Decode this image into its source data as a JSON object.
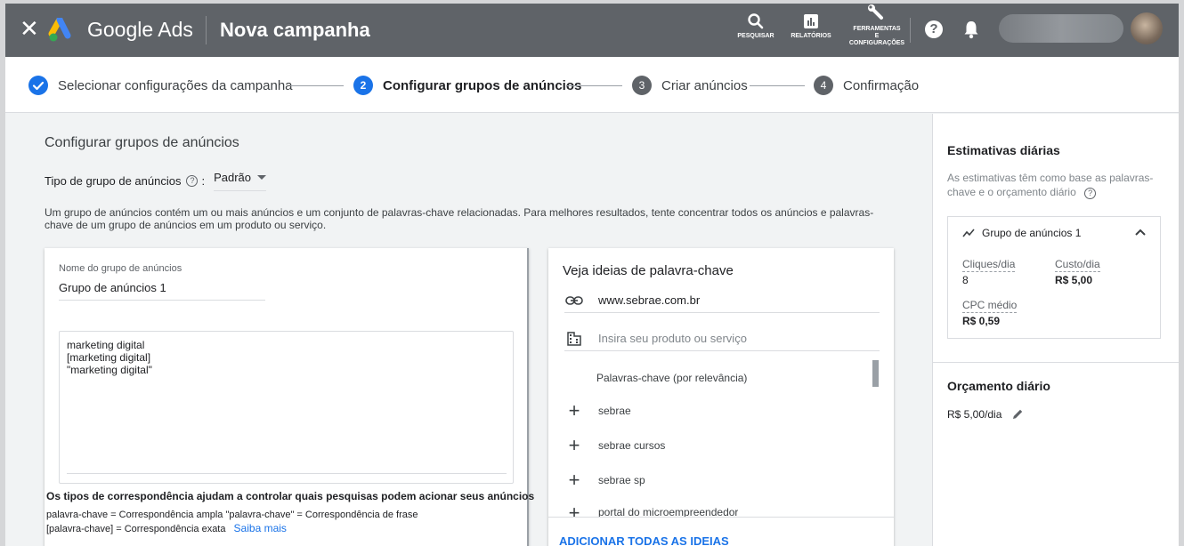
{
  "topbar": {
    "close_icon": "close-icon",
    "brand": "Google Ads",
    "page_title": "Nova campanha",
    "tools": [
      {
        "label": "PESQUISAR",
        "icon": "search-icon"
      },
      {
        "label": "RELATÓRIOS",
        "icon": "reports-icon"
      },
      {
        "label_lines": [
          "FERRAMENTAS",
          "E",
          "CONFIGURAÇÕES"
        ],
        "icon": "wrench-icon"
      }
    ],
    "help_label": "?",
    "colors": {
      "bar": "#5f6368",
      "logo_blue": "#4285f4",
      "logo_yellow": "#fbbc04",
      "logo_green": "#34a853"
    }
  },
  "stepper": {
    "steps": [
      {
        "number": "",
        "label": "Selecionar configurações da campanha",
        "state": "done"
      },
      {
        "number": "2",
        "label": "Configurar grupos de anúncios",
        "state": "active"
      },
      {
        "number": "3",
        "label": "Criar anúncios",
        "state": "pending"
      },
      {
        "number": "4",
        "label": "Confirmação",
        "state": "pending"
      }
    ],
    "colors": {
      "active": "#1a73e8",
      "pending": "#5f6368"
    }
  },
  "main": {
    "title": "Configurar grupos de anúncios",
    "type_label": "Tipo de grupo de anúncios",
    "type_value": "Padrão",
    "description": "Um grupo de anúncios contém um ou mais anúncios e um conjunto de palavras-chave relacionadas. Para melhores resultados, tente concentrar todos os anúncios e palavras-chave de um grupo de anúncios em um produto ou serviço.",
    "group_name_label": "Nome do grupo de anúncios",
    "group_name_value": "Grupo de anúncios 1",
    "keywords_text": [
      "marketing digital",
      "[marketing digital]",
      "\"marketing digital\""
    ],
    "match_title": "Os tipos de correspondência ajudam a controlar quais pesquisas podem acionar seus anúncios",
    "match_line1": "palavra-chave = Correspondência ampla  \"palavra-chave\" = Correspondência de frase",
    "match_line2": "[palavra-chave] = Correspondência exata",
    "learn_more": "Saiba mais"
  },
  "ideas": {
    "title": "Veja ideias de palavra-chave",
    "url_value": "www.sebrae.com.br",
    "product_placeholder": "Insira seu produto ou serviço",
    "list_header": "Palavras-chave (por relevância)",
    "items": [
      "sebrae",
      "sebrae cursos",
      "sebrae sp",
      "portal do microempreendedor"
    ],
    "add_all": "ADICIONAR TODAS AS IDEIAS"
  },
  "side": {
    "title": "Estimativas diárias",
    "subtitle": "As estimativas têm como base as palavras-chave e o orçamento diário",
    "group_label": "Grupo de anúncios 1",
    "metrics": {
      "clicks_label": "Cliques/dia",
      "clicks_value": "8",
      "cost_label": "Custo/dia",
      "cost_value": "R$ 5,00",
      "cpc_label": "CPC médio",
      "cpc_value": "R$ 0,59"
    },
    "budget_title": "Orçamento diário",
    "budget_value": "R$ 5,00/dia"
  }
}
